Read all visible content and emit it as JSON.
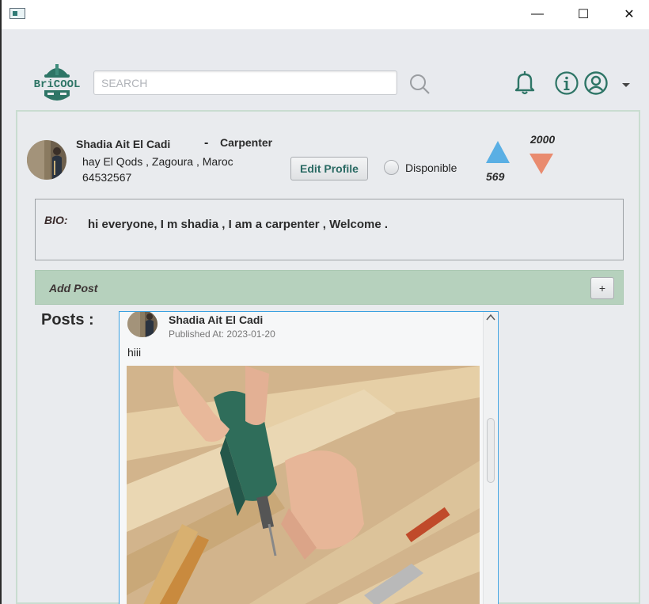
{
  "window": {
    "minimize_glyph": "—",
    "maximize_glyph": "☐",
    "close_glyph": "✕"
  },
  "header": {
    "logo_text": "BriCOOL",
    "search_placeholder": "SEARCH",
    "icons": [
      "search-icon",
      "bell-icon",
      "info-icon",
      "user-icon",
      "chevron-down-icon"
    ],
    "accent_color": "#2e7566"
  },
  "profile": {
    "name": "Shadia Ait El Cadi",
    "separator": "-",
    "job": "Carpenter",
    "address": "hay El Qods , Zagoura , Maroc",
    "phone": "64532567",
    "edit_label": "Edit Profile",
    "availability_label": "Disponible",
    "upvotes": "569",
    "downvotes": "2000",
    "up_color": "#5aafe4",
    "down_color": "#e98b6f"
  },
  "bio": {
    "label": "BIO:",
    "text": "hi everyone, I m shadia , I am a carpenter , Welcome ."
  },
  "add_post": {
    "label": "Add Post",
    "button_label": "+"
  },
  "posts": {
    "section_label": "Posts :",
    "items": [
      {
        "author": "Shadia Ait El Cadi",
        "published": "Published At: 2023-01-20",
        "text": "hiii"
      }
    ]
  }
}
